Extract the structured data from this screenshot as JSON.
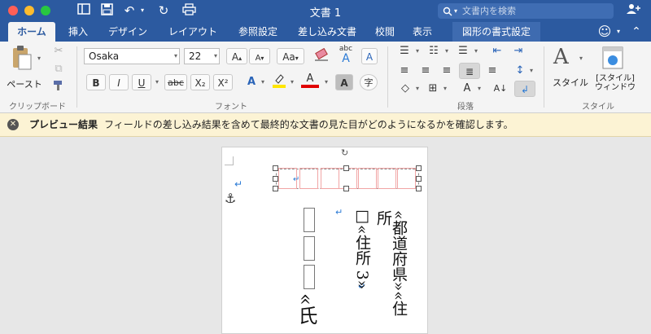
{
  "window": {
    "title": "文書 1"
  },
  "search": {
    "placeholder": "文書内を検索"
  },
  "tabs": [
    {
      "label": "ホーム",
      "active": true
    },
    {
      "label": "挿入"
    },
    {
      "label": "デザイン"
    },
    {
      "label": "レイアウト"
    },
    {
      "label": "参照設定"
    },
    {
      "label": "差し込み文書"
    },
    {
      "label": "校閲"
    },
    {
      "label": "表示"
    },
    {
      "label": "図形の書式設定",
      "contextual": true
    }
  ],
  "ribbon": {
    "clipboard": {
      "paste_label": "ペースト",
      "group_label": "クリップボード"
    },
    "font": {
      "name": "Osaka",
      "size": "22",
      "group_label": "フォント",
      "case_label": "Aa",
      "phonetic_top": "abc",
      "phonetic_bottom": "A",
      "box_label": "A",
      "bold": "B",
      "italic": "I",
      "underline": "U",
      "strike": "abc",
      "subscript": "X₂",
      "superscript": "X²",
      "effects": "A",
      "color_label": "A",
      "shade_label": "A",
      "enclose": "字"
    },
    "paragraph": {
      "group_label": "段落"
    },
    "styles": {
      "styles_label": "スタイル",
      "pane_label_1": "[スタイル]",
      "pane_label_2": "ウィンドウ",
      "group_label": "スタイル"
    }
  },
  "message_bar": {
    "title": "プレビュー結果",
    "text": "フィールドの差し込み結果を含めて最終的な文書の見た目がどのようになるかを確認します。"
  },
  "document": {
    "col1": "«都道府県»«住所",
    "col2": "□«住所 3»",
    "col3": "«氏",
    "para_mark": "↵"
  },
  "colors": {
    "accent": "#2c5aa0",
    "highlight": "#ffe600",
    "font_color": "#e00000",
    "message_bg": "#fcf3d4"
  }
}
